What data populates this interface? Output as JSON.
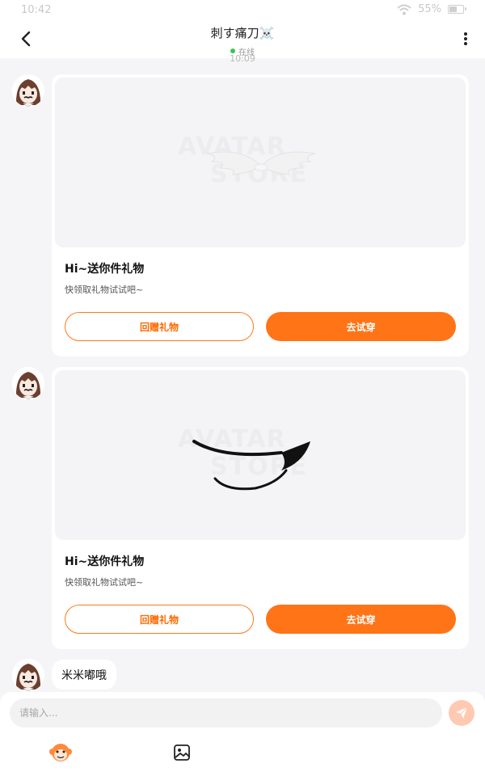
{
  "status_bar": {
    "time": "10:42",
    "battery": "55%",
    "battery_fraction": 0.55
  },
  "header": {
    "title": "刺す痛刀☠️",
    "status": "在线"
  },
  "timestamp": "10:09",
  "messages": [
    {
      "type": "gift",
      "watermark_line1": "AVATAR",
      "watermark_line2": "STORE",
      "item_icon": "angel-wings-headband",
      "title": "Hi~送你件礼物",
      "subtitle": "快领取礼物试试吧~",
      "return_gift_label": "回赠礼物",
      "try_on_label": "去试穿"
    },
    {
      "type": "gift",
      "watermark_line1": "AVATAR",
      "watermark_line2": "STORE",
      "item_icon": "eye-patch",
      "title": "Hi~送你件礼物",
      "subtitle": "快领取礼物试试吧~",
      "return_gift_label": "回赠礼物",
      "try_on_label": "去试穿"
    },
    {
      "type": "text",
      "text": "米米嘟哦"
    }
  ],
  "composer": {
    "placeholder": "请输入...",
    "value": ""
  },
  "colors": {
    "accent": "#ff7417",
    "send_disabled": "#ffc9b2",
    "online_dot": "#35c759"
  }
}
